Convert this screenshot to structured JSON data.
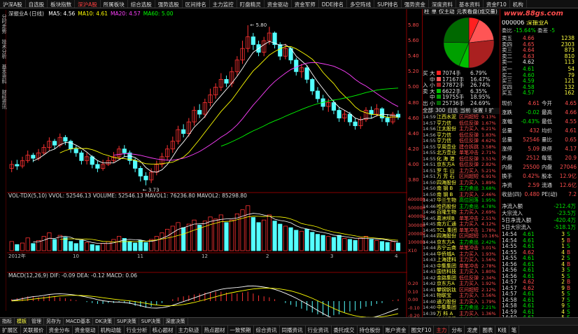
{
  "top_menu": {
    "items": [
      "沪深A股",
      "自选股",
      "板块指数",
      "深沪A股",
      "所属板块",
      "综合选股",
      "强势选股",
      "区间排名",
      "主力监控",
      "盯盘精灵",
      "资金驱动",
      "资金军师",
      "DDE排名",
      "多空阵线",
      "SUP排名",
      "强势资金",
      "深度资料",
      "基本资料",
      "资金F10",
      "机构"
    ],
    "active_index": 3
  },
  "left_tabs": [
    "分时走势",
    "技术分析",
    "基本资料",
    "财经资讯"
  ],
  "chart": {
    "title": "深振业A (日线)",
    "ma_labels": [
      "MA5: 4.56",
      "MA10: 4.61",
      "MA20: 4.57",
      "MA60: 5.00"
    ],
    "ma_colors": [
      "#ffffff",
      "#ffff00",
      "#ff40ff",
      "#00ff00"
    ],
    "high_label": "5.80",
    "low_label": "3.73",
    "price_axis": [
      "5.80",
      "5.60",
      "5.40",
      "5.20",
      "5.00",
      "4.80",
      "4.60",
      "4.40",
      "4.20",
      "4.00",
      "3.80"
    ],
    "volume_title": "VOL-TDX(5,10)  VVOL: 52546.13  VOLUME: 52546.13  MAVOL1: 76236.80  MAVOL2: 85298.80",
    "volume_axis": [
      "600000",
      "500000",
      "400000",
      "300000",
      "200000",
      "100000",
      "X10"
    ],
    "macd_title": "MACD(12,26,9)  DIF: -0.09  DEA: -0.12  MACD: 0.06",
    "macd_axis": [
      "0.20",
      "0.10",
      "0.00",
      "-0.10",
      "-0.20"
    ],
    "date_axis": [
      "2012年",
      "10",
      "11",
      "12",
      "2",
      "3",
      "4"
    ],
    "candles": [
      [
        3.95,
        4.0,
        4.05,
        3.9
      ],
      [
        4.0,
        3.98,
        4.06,
        3.93
      ],
      [
        3.98,
        4.05,
        4.1,
        3.95
      ],
      [
        4.05,
        4.12,
        4.18,
        4.02
      ],
      [
        4.12,
        4.08,
        4.15,
        4.03
      ],
      [
        4.08,
        4.15,
        4.2,
        4.05
      ],
      [
        4.15,
        4.22,
        4.26,
        4.12
      ],
      [
        4.22,
        4.3,
        4.35,
        4.18
      ],
      [
        4.3,
        4.25,
        4.33,
        4.2
      ],
      [
        4.25,
        4.35,
        4.4,
        4.22
      ],
      [
        4.35,
        4.3,
        4.38,
        4.25
      ],
      [
        4.3,
        4.2,
        4.32,
        4.15
      ],
      [
        4.2,
        4.15,
        4.24,
        4.1
      ],
      [
        4.15,
        4.05,
        4.18,
        4.0
      ],
      [
        4.05,
        4.1,
        4.15,
        4.0
      ],
      [
        4.1,
        4.0,
        4.12,
        3.95
      ],
      [
        4.0,
        3.95,
        4.05,
        3.9
      ],
      [
        3.95,
        4.0,
        4.06,
        3.92
      ],
      [
        4.0,
        4.05,
        4.1,
        3.98
      ],
      [
        4.05,
        4.1,
        4.16,
        4.02
      ],
      [
        4.1,
        4.2,
        4.24,
        4.06
      ],
      [
        4.2,
        4.15,
        4.25,
        4.1
      ],
      [
        4.15,
        4.05,
        4.18,
        4.0
      ],
      [
        4.05,
        3.95,
        4.08,
        3.9
      ],
      [
        3.95,
        3.85,
        3.98,
        3.78
      ],
      [
        3.85,
        3.8,
        3.9,
        3.73
      ],
      [
        3.8,
        3.9,
        3.95,
        3.76
      ],
      [
        3.9,
        4.0,
        4.05,
        3.86
      ],
      [
        4.0,
        4.1,
        4.15,
        3.96
      ],
      [
        4.1,
        4.2,
        4.25,
        4.05
      ],
      [
        4.2,
        4.3,
        4.36,
        4.15
      ],
      [
        4.3,
        4.45,
        4.5,
        4.26
      ],
      [
        4.45,
        4.4,
        4.52,
        4.35
      ],
      [
        4.4,
        4.55,
        4.6,
        4.36
      ],
      [
        4.55,
        4.7,
        4.75,
        4.5
      ],
      [
        4.7,
        4.65,
        4.78,
        4.6
      ],
      [
        4.65,
        4.8,
        4.85,
        4.6
      ],
      [
        4.8,
        4.9,
        4.98,
        4.75
      ],
      [
        4.9,
        5.0,
        5.05,
        4.85
      ],
      [
        5.0,
        5.1,
        5.18,
        4.95
      ],
      [
        5.1,
        5.05,
        5.15,
        5.0
      ],
      [
        5.05,
        5.2,
        5.26,
        5.0
      ],
      [
        5.2,
        5.35,
        5.4,
        5.15
      ],
      [
        5.35,
        5.5,
        5.6,
        5.3
      ],
      [
        5.5,
        5.65,
        5.8,
        5.45
      ],
      [
        5.65,
        5.55,
        5.7,
        5.48
      ],
      [
        5.55,
        5.45,
        5.6,
        5.4
      ],
      [
        5.45,
        5.6,
        5.65,
        5.4
      ],
      [
        5.6,
        5.7,
        5.78,
        5.55
      ],
      [
        5.7,
        5.55,
        5.72,
        5.5
      ],
      [
        5.55,
        5.4,
        5.58,
        5.35
      ],
      [
        5.4,
        5.5,
        5.56,
        5.36
      ],
      [
        5.5,
        5.35,
        5.52,
        5.3
      ],
      [
        5.35,
        5.2,
        5.38,
        5.15
      ],
      [
        5.2,
        5.25,
        5.3,
        5.12
      ],
      [
        5.25,
        5.1,
        5.28,
        5.05
      ],
      [
        5.1,
        4.95,
        5.12,
        4.9
      ],
      [
        4.95,
        4.85,
        5.0,
        4.8
      ],
      [
        4.85,
        4.75,
        4.9,
        4.7
      ],
      [
        4.75,
        4.8,
        4.85,
        4.68
      ],
      [
        4.8,
        4.7,
        4.84,
        4.65
      ],
      [
        4.7,
        4.6,
        4.74,
        4.55
      ],
      [
        4.6,
        4.65,
        4.7,
        4.55
      ],
      [
        4.65,
        4.55,
        4.68,
        4.5
      ],
      [
        4.55,
        4.5,
        4.6,
        4.45
      ],
      [
        4.5,
        4.58,
        4.62,
        4.46
      ],
      [
        4.58,
        4.7,
        4.74,
        4.55
      ],
      [
        4.7,
        4.65,
        4.75,
        4.6
      ],
      [
        4.65,
        4.72,
        4.78,
        4.62
      ],
      [
        4.72,
        4.6,
        4.74,
        4.55
      ],
      [
        4.6,
        4.55,
        4.65,
        4.5
      ],
      [
        4.55,
        4.65,
        4.68,
        4.52
      ],
      [
        4.65,
        4.61,
        4.7,
        4.58
      ]
    ],
    "volumes": [
      18,
      12,
      15,
      25,
      14,
      20,
      28,
      35,
      22,
      30,
      26,
      18,
      14,
      20,
      16,
      12,
      10,
      14,
      18,
      22,
      28,
      24,
      18,
      15,
      20,
      16,
      22,
      28,
      35,
      42,
      48,
      55,
      45,
      52,
      60,
      50,
      58,
      66,
      62,
      70,
      55,
      60,
      72,
      80,
      88,
      65,
      55,
      60,
      70,
      58,
      52,
      48,
      45,
      40,
      38,
      42,
      36,
      32,
      30,
      28,
      26,
      30,
      24,
      22,
      20,
      25,
      28,
      22,
      20,
      18,
      16,
      18,
      15
    ],
    "macd_hist": [
      0.02,
      0.03,
      0.04,
      0.05,
      0.05,
      0.04,
      0.05,
      0.06,
      0.05,
      0.04,
      0.03,
      0.02,
      0.01,
      0.0,
      -0.01,
      -0.02,
      -0.03,
      -0.03,
      -0.02,
      -0.02,
      -0.01,
      -0.02,
      -0.03,
      -0.05,
      -0.06,
      -0.07,
      -0.06,
      -0.04,
      -0.02,
      0.0,
      0.02,
      0.04,
      0.05,
      0.06,
      0.07,
      0.08,
      0.09,
      0.09,
      0.1,
      0.1,
      0.09,
      0.08,
      0.08,
      0.09,
      0.1,
      0.08,
      0.06,
      0.05,
      0.04,
      0.02,
      0.0,
      -0.02,
      -0.04,
      -0.06,
      -0.08,
      -0.1,
      -0.12,
      -0.14,
      -0.15,
      -0.16,
      -0.15,
      -0.14,
      -0.12,
      -0.11,
      -0.1,
      -0.08,
      -0.06,
      -0.05,
      -0.03,
      -0.02,
      0.0,
      0.01,
      0.02
    ]
  },
  "flow_panel": {
    "header": [
      "柱",
      "单",
      "仅主动",
      "元表看盘(成交量)",
      "价格"
    ],
    "rows": [
      {
        "side": "买",
        "size": "大",
        "value": "7074手",
        "pct": "6.79%"
      },
      {
        "side": "",
        "size": "中",
        "value": "17167手",
        "pct": "16.47%"
      },
      {
        "side": "入",
        "size": "小",
        "value": "27872手",
        "pct": "26.74%"
      },
      {
        "side": "卖",
        "size": "大",
        "value": "6622手",
        "pct": "6.35%"
      },
      {
        "side": "",
        "size": "中",
        "value": "19755手",
        "pct": "18.95%"
      },
      {
        "side": "出",
        "size": "小",
        "value": "25736手",
        "pct": "24.69%"
      }
    ],
    "tabs": [
      "全部",
      "300",
      "自选",
      "当前",
      "设置",
      "I",
      "扩"
    ],
    "events": [
      {
        "time": "14:59",
        "name": "江西水泥",
        "type": "区间超短",
        "value": "9.13%"
      },
      {
        "time": "14:57",
        "name": "亨力信",
        "type": "低位反弹",
        "value": "1.67%"
      },
      {
        "time": "14:56",
        "name": "江太股份",
        "type": "主力买入",
        "value": "6.21%"
      },
      {
        "time": "14:56",
        "name": "亨力信",
        "type": "低位反弹",
        "value": "1.83%"
      },
      {
        "time": "14:55",
        "name": "亨力信",
        "type": "低位反弹",
        "value": "4.62%"
      },
      {
        "time": "14:55",
        "name": "亨周壶业",
        "type": "建仓拆跳",
        "value": "3.58%"
      },
      {
        "time": "14:55",
        "name": "北方壶业",
        "type": "单笔冲击",
        "value": "2.71%"
      },
      {
        "time": "14:55",
        "name": "化 海 港",
        "type": "低位反弹",
        "value": "3.51%"
      },
      {
        "time": "14:51",
        "name": "京东方A",
        "type": "低位反弹",
        "value": "2.82%"
      },
      {
        "time": "14:51",
        "name": "罗 牛 山",
        "type": "主力买入",
        "value": "5.21%"
      },
      {
        "time": "14:51",
        "name": "万 芳 石",
        "type": "区间超短",
        "value": "6.91%"
      },
      {
        "time": "14:50",
        "name": "四海股份",
        "type": "主力买入",
        "value": "1.89%"
      },
      {
        "time": "14:50",
        "name": "南 钢 B",
        "type": "主力卖出",
        "value": "3.68%"
      },
      {
        "time": "14:50",
        "name": "南 钢 B",
        "type": "主力买入",
        "value": "2.46%"
      },
      {
        "time": "14:47",
        "name": "华兰生物",
        "type": "高位回落",
        "value": "1.95%"
      },
      {
        "time": "14:46",
        "name": "哈药股份",
        "type": "主力卖出",
        "value": "4.78%"
      },
      {
        "time": "14:46",
        "name": "百隆生物",
        "type": "主力买入",
        "value": "2.69%"
      },
      {
        "time": "14:45",
        "name": "葛洲坝B",
        "type": "单笔冲击",
        "value": "2.51%"
      },
      {
        "time": "14:45",
        "name": "南方汇通",
        "type": "主力买入",
        "value": "4.12%"
      },
      {
        "time": "14:45",
        "name": "TCL 集团",
        "type": "单笔冲击",
        "value": "1.78%"
      },
      {
        "time": "14:44",
        "name": "四海股份",
        "type": "区间超短",
        "value": "10.16%"
      },
      {
        "time": "14:44",
        "name": "京东方A",
        "type": "主力卖出",
        "value": "2.42%"
      },
      {
        "time": "14:44",
        "name": "苏宁云商",
        "type": "单笔冲击",
        "value": "3.01%"
      },
      {
        "time": "14:44",
        "name": "华侨城A",
        "type": "主力买入",
        "value": "1.93%"
      },
      {
        "time": "14:43",
        "name": "上海建科",
        "type": "主力买入",
        "value": "1.56%"
      },
      {
        "time": "14:43",
        "name": "中集集团",
        "type": "单笔冲击",
        "value": "2.78%"
      },
      {
        "time": "14:43",
        "name": "国信科技",
        "type": "主力买入",
        "value": "1.80%"
      },
      {
        "time": "14:42",
        "name": "金路集团",
        "type": "低位反弹",
        "value": "2.34%"
      },
      {
        "time": "14:42",
        "name": "京东方A",
        "type": "主力买入",
        "value": "1.92%"
      },
      {
        "time": "14:41",
        "name": "攀钢钒钛",
        "type": "区间超短",
        "value": "2.12%"
      },
      {
        "time": "14:41",
        "name": "物联宝",
        "type": "主力买入",
        "value": "3.56%"
      },
      {
        "time": "14:40",
        "name": "通力股份",
        "type": "主力买入",
        "value": "1.79%"
      },
      {
        "time": "14:40",
        "name": "中集集团",
        "type": "主力卖出",
        "value": "2.21%"
      },
      {
        "time": "14:39",
        "name": "万 科 A",
        "type": "主力买入",
        "value": "1.36%"
      },
      {
        "time": "14:38",
        "name": "中兴通讯",
        "type": "主力卖出",
        "value": "2.04%"
      }
    ]
  },
  "quote": {
    "watermark": "www.88gs.com",
    "code": "000006",
    "name": "深振业A",
    "weibi_label": "委比",
    "weibi": "-15.64%",
    "weicha_label": "委差",
    "weicha": "-5",
    "asks": [
      {
        "label": "卖五",
        "price": "4.66",
        "vol": "1238"
      },
      {
        "label": "卖四",
        "price": "4.65",
        "vol": "2303"
      },
      {
        "label": "卖三",
        "price": "4.64",
        "vol": "873"
      },
      {
        "label": "卖二",
        "price": "4.63",
        "vol": "810"
      },
      {
        "label": "卖一",
        "price": "4.62",
        "vol": "113"
      }
    ],
    "bids": [
      {
        "label": "买一",
        "price": "4.61",
        "vol": "54"
      },
      {
        "label": "买二",
        "price": "4.60",
        "vol": "79"
      },
      {
        "label": "买三",
        "price": "4.59",
        "vol": "121"
      },
      {
        "label": "买四",
        "price": "4.58",
        "vol": "132"
      },
      {
        "label": "买五",
        "price": "4.57",
        "vol": "162"
      }
    ],
    "stats": [
      {
        "l1": "现价",
        "v1": "4.61",
        "l2": "今开",
        "v2": "4.65"
      },
      {
        "l1": "涨跌",
        "v1": "-0.02",
        "l2": "最高",
        "v2": "4.66"
      },
      {
        "l1": "涨幅",
        "v1": "-0.43%",
        "l2": "最低",
        "v2": "4.55"
      },
      {
        "l1": "总量",
        "v1": "432",
        "l2": "均价",
        "v2": "4.61"
      },
      {
        "l1": "总量",
        "v1": "52546",
        "l2": "量比",
        "v2": "0.65"
      },
      {
        "l1": "涨停",
        "v1": "5.09",
        "l2": "跌停",
        "v2": "4.17"
      },
      {
        "l1": "外盘",
        "v1": "2512",
        "l2": "每笔",
        "v2": "20.9"
      },
      {
        "l1": "内盘",
        "v1": "25500",
        "l2": "内盘",
        "v2": "27046"
      },
      {
        "l1": "换手",
        "v1": "0.42%",
        "l2": "股本",
        "v2": "12.9亿"
      },
      {
        "l1": "净资",
        "v1": "2.59",
        "l2": "流通",
        "v2": "12.6亿"
      },
      {
        "l1": "收益(四)",
        "v1": "0.480",
        "l2": "PE(动)",
        "v2": "7.2"
      }
    ],
    "flows": [
      {
        "label": "净流入额",
        "value": "-212.4万"
      },
      {
        "label": "大宗流入",
        "value": "-23.5万"
      },
      {
        "label": "5日净流入额",
        "value": "-420.4万"
      },
      {
        "label": "5日大宗流入",
        "value": "-518.1万"
      }
    ],
    "ticks": [
      {
        "time": "14:54",
        "price": "4.61",
        "vol": "3",
        "dir": "S"
      },
      {
        "time": "14:54",
        "price": "4.61",
        "vol": "5",
        "dir": "B"
      },
      {
        "time": "14:55",
        "price": "4.61",
        "vol": "1",
        "dir": "S"
      },
      {
        "time": "14:55",
        "price": "4.62",
        "vol": "4",
        "dir": "B"
      },
      {
        "time": "14:55",
        "price": "4.61",
        "vol": "2",
        "dir": "S"
      },
      {
        "time": "14:56",
        "price": "4.61",
        "vol": "4",
        "dir": "B"
      },
      {
        "time": "14:56",
        "price": "4.61",
        "vol": "3",
        "dir": "S"
      },
      {
        "time": "14:56",
        "price": "4.61",
        "vol": "5",
        "dir": "S"
      },
      {
        "time": "14:57",
        "price": "4.62",
        "vol": "2",
        "dir": "B"
      },
      {
        "time": "14:57",
        "price": "4.62",
        "vol": "9",
        "dir": "B"
      },
      {
        "time": "14:57",
        "price": "4.61",
        "vol": "5",
        "dir": "S"
      },
      {
        "time": "14:58",
        "price": "4.61",
        "vol": "7",
        "dir": "S"
      },
      {
        "time": "14:58",
        "price": "4.61",
        "vol": "9",
        "dir": "S"
      },
      {
        "time": "14:59",
        "price": "4.61",
        "vol": "4",
        "dir": "S"
      },
      {
        "time": "14:59",
        "price": "4.61",
        "vol": "5",
        "dir": "S"
      },
      {
        "time": "15:00",
        "price": "4.61",
        "vol": "432",
        "dir": ""
      }
    ]
  },
  "bottom_tabs": [
    "指标",
    "模板",
    "管理",
    "另存为",
    "MACD基本",
    "DK决策",
    "SUP决策",
    "SUP决策",
    "深度决策"
  ],
  "bottom_bar": [
    "扩展区",
    "关联报价",
    "资金分布",
    "资金驱动",
    "机构动能",
    "行业分析",
    "核心题材",
    "主力轨迹",
    "热点题材",
    "一致预期",
    "综合资讯",
    "同播资讯",
    "行业资讯",
    "委托成交",
    "持仓股份",
    "账户资金",
    "图文F10",
    "主力",
    "分布",
    "龙虎",
    "图表",
    "K线",
    "笔"
  ],
  "bottom_active": 17
}
